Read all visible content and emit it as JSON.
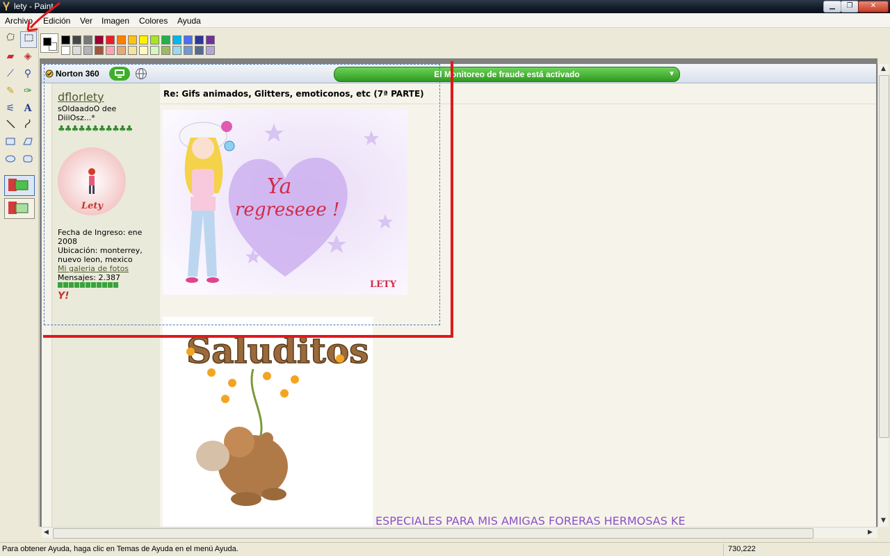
{
  "window": {
    "title": "lety - Paint",
    "controls": [
      "minimize",
      "maximize",
      "close"
    ]
  },
  "menu": [
    "Archivo",
    "Edición",
    "Ver",
    "Imagen",
    "Colores",
    "Ayuda"
  ],
  "tools": [
    "free-form-select",
    "rectangle-select",
    "eraser",
    "fill-bucket",
    "color-picker",
    "magnifier",
    "pencil",
    "brush",
    "airbrush",
    "text",
    "line",
    "curve",
    "rectangle",
    "polygon",
    "ellipse",
    "rounded-rectangle"
  ],
  "selected_tool": "rectangle-select",
  "palette": {
    "foreground": "#000000",
    "background": "#ffffff",
    "row1": [
      "#000000",
      "#464646",
      "#787878",
      "#990030",
      "#ed1c24",
      "#ff7e00",
      "#ffc20e",
      "#fff200",
      "#a8e61d",
      "#22b14c",
      "#00b7ef",
      "#4d6df3",
      "#2f3699",
      "#6f3198"
    ],
    "row2": [
      "#ffffff",
      "#dcdcdc",
      "#b4b4b4",
      "#9c5a3c",
      "#ffa3b1",
      "#e5aa7a",
      "#f5e49c",
      "#fff9bd",
      "#d3f9bc",
      "#9dbb61",
      "#99d9ea",
      "#709ad1",
      "#546d8e",
      "#b5a5d5"
    ]
  },
  "image": {
    "norton": {
      "label": "Norton 360",
      "fraud_status": "El Monitoreo de fraude está activado"
    },
    "profile": {
      "username": "dflorlety",
      "user_title": "sOldaadoO dee DiiiOsz...*",
      "clovers": "♣♣♣♣♣♣♣♣♣♣♣",
      "avatar_name": "Lety",
      "join_date": "Fecha de Ingreso: ene 2008",
      "location": "Ubicación: monterrey, nuevo leon, mexico",
      "gallery_link": "Mi galeria de fotos",
      "messages": "Mensajes: 2.387",
      "yahoo": "Y!"
    },
    "post": {
      "title": "Re: Gifs animados, Glitters, emoticonos, etc (7ª PARTE)",
      "gif1_text_1": "Ya",
      "gif1_text_2": "regreseee !",
      "gif1_signature": "LETY",
      "gif2_text": "Saluditos",
      "footer_text": "ESPECIALES PARA MIS AMIGAS FORERAS HERMOSAS KE"
    }
  },
  "status": {
    "help": "Para obtener Ayuda, haga clic en Temas de Ayuda en el menú Ayuda.",
    "coords": "730,222"
  },
  "colors": {
    "annotation_red": "#e0181c",
    "selection_blue": "#4a79b8",
    "norton_green": "#3fae2a"
  }
}
